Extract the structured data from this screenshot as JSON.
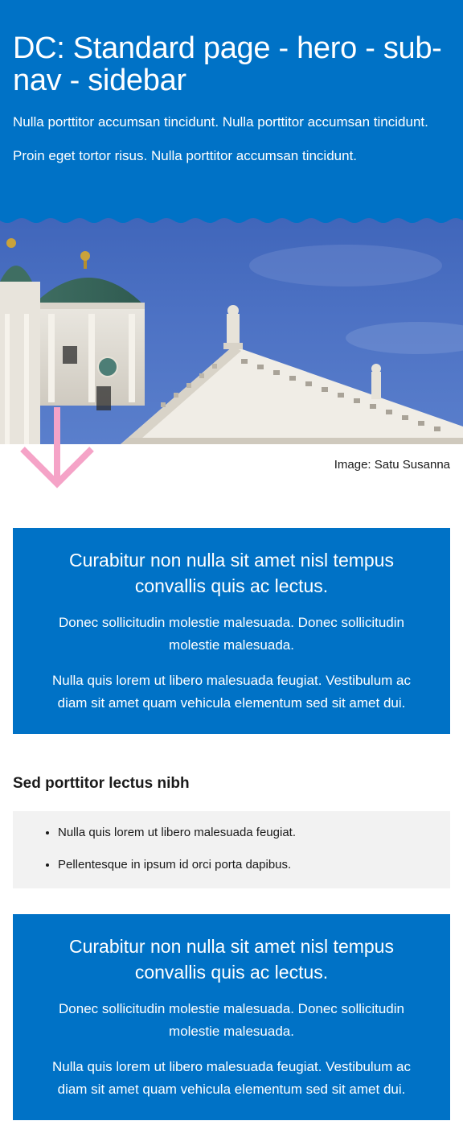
{
  "hero": {
    "title": "DC: Standard page - hero - sub-nav - sidebar",
    "lead_1": "Nulla porttitor accumsan tincidunt. Nulla porttitor accumsan tincidunt.",
    "lead_2": "Proin eget tortor risus. Nulla porttitor accumsan tincidunt.",
    "background_color": "#0072c6"
  },
  "image": {
    "caption": "Image: Satu Susanna",
    "arrow_icon": "arrow-down-icon",
    "arrow_color": "#f5a3c7"
  },
  "info_box_1": {
    "title": "Curabitur non nulla sit amet nisl tempus convallis quis ac lectus.",
    "paragraph_1": "Donec sollicitudin molestie malesuada. Donec sollicitudin molestie malesuada.",
    "paragraph_2": "Nulla quis lorem ut libero malesuada feugiat. Vestibulum ac diam sit amet quam vehicula elementum sed sit amet dui."
  },
  "section": {
    "heading": "Sed porttitor lectus nibh",
    "list_items": [
      "Nulla quis lorem ut libero malesuada feugiat.",
      "Pellentesque in ipsum id orci porta dapibus."
    ],
    "list_background": "#f2f2f2"
  },
  "info_box_2": {
    "title": "Curabitur non nulla sit amet nisl tempus convallis quis ac lectus.",
    "paragraph_1": "Donec sollicitudin molestie malesuada. Donec sollicitudin molestie malesuada.",
    "paragraph_2": "Nulla quis lorem ut libero malesuada feugiat. Vestibulum ac diam sit amet quam vehicula elementum sed sit amet dui."
  }
}
